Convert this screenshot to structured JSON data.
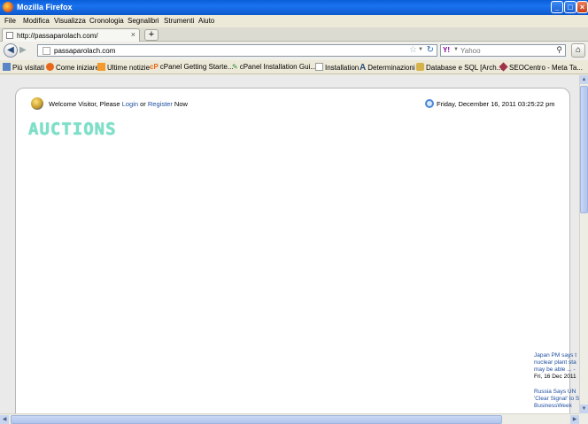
{
  "window": {
    "title": "Mozilla Firefox",
    "buttons": {
      "minimize": "_",
      "maximize": "□",
      "close": "×"
    }
  },
  "menu": [
    "File",
    "Modifica",
    "Visualizza",
    "Cronologia",
    "Segnalibri",
    "Strumenti",
    "Aiuto"
  ],
  "tab": {
    "label": "http://passaparolach.com/",
    "close": "×",
    "new_tab": "+"
  },
  "nav": {
    "url": "passaparolach.com",
    "search_engine": "Y!",
    "search_placeholder": "Yahoo"
  },
  "bookmarks": [
    "Più visitati",
    "Come iniziare",
    "Ultime notizie",
    "cPanel Getting Starte...",
    "cPanel Installation Gui...",
    "Installation",
    "Determinazioni",
    "Database e SQL [Arch...",
    "SEOCentro - Meta Ta..."
  ],
  "page": {
    "welcome_prefix": "Welcome Visitor, Please ",
    "login": "Login",
    "or": " or ",
    "register": "Register",
    "welcome_suffix": " Now",
    "datetime": "Friday, December 16, 2011 03:25:22 pm",
    "brand": "AUCTIONS"
  },
  "news": [
    {
      "lines": [
        "Japan PM says t",
        "nuclear plant sta",
        "may be able ... -"
      ],
      "date": "Fri, 16 Dec 2011"
    },
    {
      "lines": [
        "Russia Says UN",
        "'Clear Signal' to S",
        "BusinessWeek"
      ],
      "date": ""
    }
  ],
  "colors": {
    "titlebar": "#0a5fd8",
    "link": "#1f4fa0",
    "brand": "#7de0c8"
  }
}
